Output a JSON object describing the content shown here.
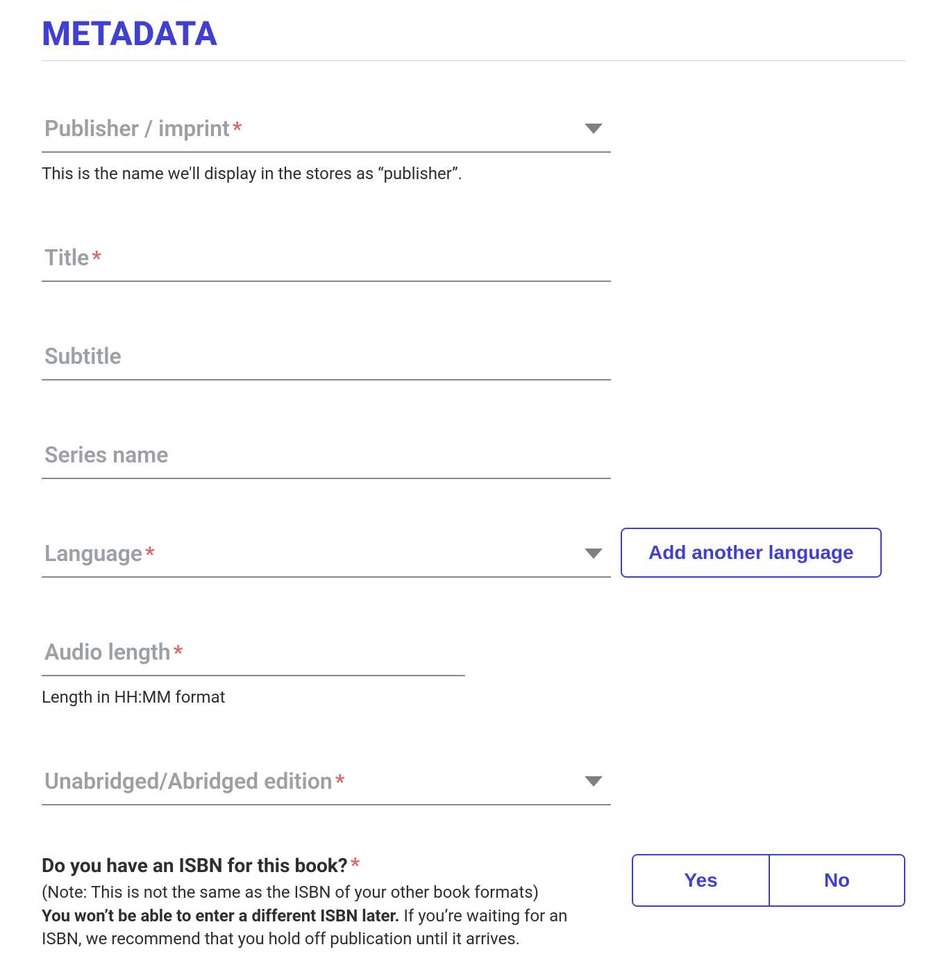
{
  "section": {
    "title": "METADATA"
  },
  "fields": {
    "publisher": {
      "label": "Publisher / imprint",
      "required": "*",
      "helper": "This is the name we'll display in the stores as “publisher”."
    },
    "title": {
      "label": "Title",
      "required": "*"
    },
    "subtitle": {
      "label": "Subtitle"
    },
    "series": {
      "label": "Series name"
    },
    "language": {
      "label": "Language",
      "required": "*",
      "add_button": "Add another language"
    },
    "audio_length": {
      "label": "Audio length",
      "required": "*",
      "helper": "Length in HH:MM format"
    },
    "edition": {
      "label": "Unabridged/Abridged edition",
      "required": "*"
    }
  },
  "isbn": {
    "question": "Do you have an ISBN for this book?",
    "required": "*",
    "note_paren": "(Note: This is not the same as the ISBN of your other book formats)",
    "note_bold": "You won’t be able to enter a different ISBN later.",
    "note_rest": " If you’re waiting for an ISBN, we recommend that you hold off publication until it arrives.",
    "yes": "Yes",
    "no": "No"
  }
}
